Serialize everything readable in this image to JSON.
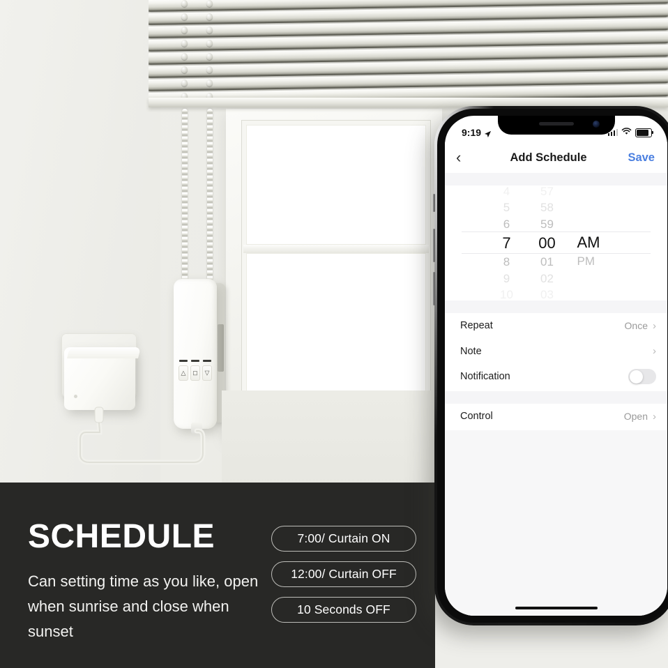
{
  "scene": {
    "background_color": "#eeeeea",
    "banner_color": "#282826"
  },
  "banner": {
    "headline": "SCHEDULE",
    "subcopy": "Can setting time as you like, open when sunrise and close when sunset",
    "pills": [
      "7:00/ Curtain ON",
      "12:00/ Curtain OFF",
      "10 Seconds OFF"
    ]
  },
  "phone": {
    "status_bar": {
      "time": "9:19",
      "location_icon": "location-arrow-icon",
      "signal_icon": "cellular-signal-icon",
      "wifi_icon": "wifi-icon",
      "battery_icon": "battery-icon"
    },
    "nav": {
      "back_icon": "chevron-left-icon",
      "title": "Add Schedule",
      "save_label": "Save",
      "save_color": "#4a7fe0"
    },
    "time_picker": {
      "hours": [
        "4",
        "5",
        "6",
        "7",
        "8",
        "9",
        "10"
      ],
      "minutes": [
        "57",
        "58",
        "59",
        "00",
        "01",
        "02",
        "03"
      ],
      "periods": [
        "AM",
        "PM"
      ],
      "selected_hour": "7",
      "selected_minute": "00",
      "selected_period": "AM"
    },
    "settings_group_1": [
      {
        "label": "Repeat",
        "value": "Once",
        "accessory": "chevron"
      },
      {
        "label": "Note",
        "value": "",
        "accessory": "chevron"
      },
      {
        "label": "Notification",
        "value": "",
        "accessory": "switch",
        "switch_on": false
      }
    ],
    "settings_group_2": [
      {
        "label": "Control",
        "value": "Open",
        "accessory": "chevron"
      }
    ],
    "chevron_glyph": "›",
    "back_glyph": "‹",
    "home_indicator": "home-indicator"
  }
}
